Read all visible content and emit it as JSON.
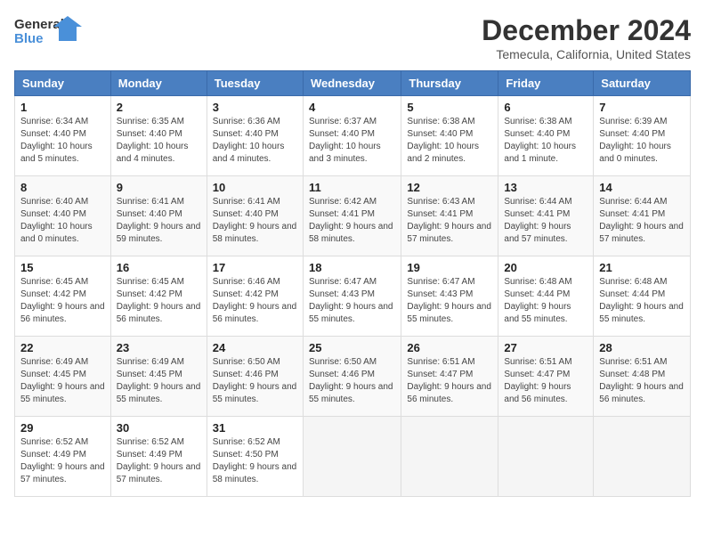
{
  "logo": {
    "line1": "General",
    "line2": "Blue"
  },
  "title": "December 2024",
  "subtitle": "Temecula, California, United States",
  "headers": [
    "Sunday",
    "Monday",
    "Tuesday",
    "Wednesday",
    "Thursday",
    "Friday",
    "Saturday"
  ],
  "weeks": [
    [
      {
        "day": "1",
        "sunrise": "6:34 AM",
        "sunset": "4:40 PM",
        "daylight": "10 hours and 5 minutes."
      },
      {
        "day": "2",
        "sunrise": "6:35 AM",
        "sunset": "4:40 PM",
        "daylight": "10 hours and 4 minutes."
      },
      {
        "day": "3",
        "sunrise": "6:36 AM",
        "sunset": "4:40 PM",
        "daylight": "10 hours and 4 minutes."
      },
      {
        "day": "4",
        "sunrise": "6:37 AM",
        "sunset": "4:40 PM",
        "daylight": "10 hours and 3 minutes."
      },
      {
        "day": "5",
        "sunrise": "6:38 AM",
        "sunset": "4:40 PM",
        "daylight": "10 hours and 2 minutes."
      },
      {
        "day": "6",
        "sunrise": "6:38 AM",
        "sunset": "4:40 PM",
        "daylight": "10 hours and 1 minute."
      },
      {
        "day": "7",
        "sunrise": "6:39 AM",
        "sunset": "4:40 PM",
        "daylight": "10 hours and 0 minutes."
      }
    ],
    [
      {
        "day": "8",
        "sunrise": "6:40 AM",
        "sunset": "4:40 PM",
        "daylight": "10 hours and 0 minutes."
      },
      {
        "day": "9",
        "sunrise": "6:41 AM",
        "sunset": "4:40 PM",
        "daylight": "9 hours and 59 minutes."
      },
      {
        "day": "10",
        "sunrise": "6:41 AM",
        "sunset": "4:40 PM",
        "daylight": "9 hours and 58 minutes."
      },
      {
        "day": "11",
        "sunrise": "6:42 AM",
        "sunset": "4:41 PM",
        "daylight": "9 hours and 58 minutes."
      },
      {
        "day": "12",
        "sunrise": "6:43 AM",
        "sunset": "4:41 PM",
        "daylight": "9 hours and 57 minutes."
      },
      {
        "day": "13",
        "sunrise": "6:44 AM",
        "sunset": "4:41 PM",
        "daylight": "9 hours and 57 minutes."
      },
      {
        "day": "14",
        "sunrise": "6:44 AM",
        "sunset": "4:41 PM",
        "daylight": "9 hours and 57 minutes."
      }
    ],
    [
      {
        "day": "15",
        "sunrise": "6:45 AM",
        "sunset": "4:42 PM",
        "daylight": "9 hours and 56 minutes."
      },
      {
        "day": "16",
        "sunrise": "6:45 AM",
        "sunset": "4:42 PM",
        "daylight": "9 hours and 56 minutes."
      },
      {
        "day": "17",
        "sunrise": "6:46 AM",
        "sunset": "4:42 PM",
        "daylight": "9 hours and 56 minutes."
      },
      {
        "day": "18",
        "sunrise": "6:47 AM",
        "sunset": "4:43 PM",
        "daylight": "9 hours and 55 minutes."
      },
      {
        "day": "19",
        "sunrise": "6:47 AM",
        "sunset": "4:43 PM",
        "daylight": "9 hours and 55 minutes."
      },
      {
        "day": "20",
        "sunrise": "6:48 AM",
        "sunset": "4:44 PM",
        "daylight": "9 hours and 55 minutes."
      },
      {
        "day": "21",
        "sunrise": "6:48 AM",
        "sunset": "4:44 PM",
        "daylight": "9 hours and 55 minutes."
      }
    ],
    [
      {
        "day": "22",
        "sunrise": "6:49 AM",
        "sunset": "4:45 PM",
        "daylight": "9 hours and 55 minutes."
      },
      {
        "day": "23",
        "sunrise": "6:49 AM",
        "sunset": "4:45 PM",
        "daylight": "9 hours and 55 minutes."
      },
      {
        "day": "24",
        "sunrise": "6:50 AM",
        "sunset": "4:46 PM",
        "daylight": "9 hours and 55 minutes."
      },
      {
        "day": "25",
        "sunrise": "6:50 AM",
        "sunset": "4:46 PM",
        "daylight": "9 hours and 55 minutes."
      },
      {
        "day": "26",
        "sunrise": "6:51 AM",
        "sunset": "4:47 PM",
        "daylight": "9 hours and 56 minutes."
      },
      {
        "day": "27",
        "sunrise": "6:51 AM",
        "sunset": "4:47 PM",
        "daylight": "9 hours and 56 minutes."
      },
      {
        "day": "28",
        "sunrise": "6:51 AM",
        "sunset": "4:48 PM",
        "daylight": "9 hours and 56 minutes."
      }
    ],
    [
      {
        "day": "29",
        "sunrise": "6:52 AM",
        "sunset": "4:49 PM",
        "daylight": "9 hours and 57 minutes."
      },
      {
        "day": "30",
        "sunrise": "6:52 AM",
        "sunset": "4:49 PM",
        "daylight": "9 hours and 57 minutes."
      },
      {
        "day": "31",
        "sunrise": "6:52 AM",
        "sunset": "4:50 PM",
        "daylight": "9 hours and 58 minutes."
      },
      null,
      null,
      null,
      null
    ]
  ],
  "labels": {
    "sunrise": "Sunrise: ",
    "sunset": "Sunset: ",
    "daylight": "Daylight: "
  }
}
